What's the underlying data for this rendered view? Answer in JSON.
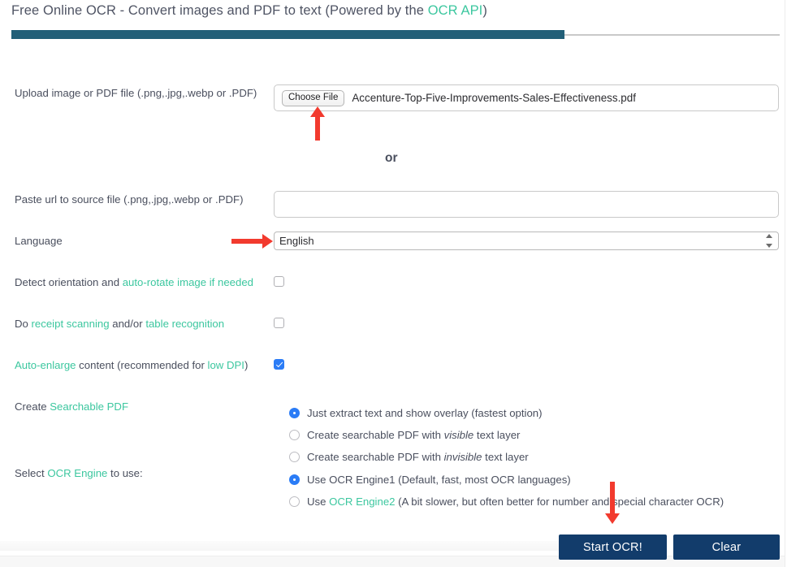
{
  "header": {
    "title_pre": "Free Online OCR - Convert images and PDF to text (Powered by the ",
    "title_link": "OCR API",
    "title_post": ")",
    "progress_percent": 72
  },
  "upload": {
    "label": "Upload image or PDF file (.png,.jpg,.webp or .PDF)",
    "choose_file_label": "Choose File",
    "file_name": "Accenture-Top-Five-Improvements-Sales-Effectiveness.pdf"
  },
  "separator": {
    "or_label": "or"
  },
  "url": {
    "label": "Paste url to source file (.png,.jpg,.webp or .PDF)",
    "value": "",
    "placeholder": ""
  },
  "language": {
    "label": "Language",
    "selected": "English",
    "options": [
      "English"
    ]
  },
  "options": [
    {
      "name": "detect-orientation",
      "text_pre": "Detect orientation and ",
      "text_link": "auto-rotate image if needed",
      "text_post": "",
      "checked": false
    },
    {
      "name": "receipt-table",
      "text_pre": "Do ",
      "text_link": "receipt scanning",
      "text_mid": " and/or ",
      "text_link2": "table recognition",
      "text_post": "",
      "checked": false
    },
    {
      "name": "auto-enlarge",
      "text_link": "Auto-enlarge",
      "text_mid": " content (recommended for ",
      "text_link2": "low DPI",
      "text_post": ")",
      "checked": true
    }
  ],
  "searchable_pdf": {
    "label_pre": "Create ",
    "label_link": "Searchable PDF",
    "options": [
      {
        "label": "Just extract text and show overlay (fastest option)",
        "selected": true
      },
      {
        "label_pre": "Create searchable PDF with ",
        "label_em": "visible",
        "label_post": " text layer",
        "selected": false
      },
      {
        "label_pre": "Create searchable PDF with ",
        "label_em": "invisible",
        "label_post": " text layer",
        "selected": false
      }
    ]
  },
  "ocr_engine": {
    "label_pre": "Select ",
    "label_link": "OCR Engine",
    "label_post": " to use:",
    "options": [
      {
        "label": "Use OCR Engine1 (Default, fast, most OCR languages)",
        "selected": true
      },
      {
        "label_pre": "Use ",
        "label_link": "OCR Engine2",
        "label_post": " (A bit slower, but often better for number and special character OCR)",
        "selected": false
      }
    ]
  },
  "actions": {
    "start_label": "Start OCR!",
    "clear_label": "Clear"
  },
  "colors": {
    "link_green": "#3cc79f",
    "progress_teal": "#225f78",
    "button_navy": "#123c6b",
    "accent_blue": "#2b7cf6",
    "arrow_red": "#f23a2e"
  },
  "annotations": [
    {
      "name": "arrow-choose-file",
      "direction": "up"
    },
    {
      "name": "arrow-language",
      "direction": "right"
    },
    {
      "name": "arrow-start-ocr",
      "direction": "down"
    }
  ]
}
